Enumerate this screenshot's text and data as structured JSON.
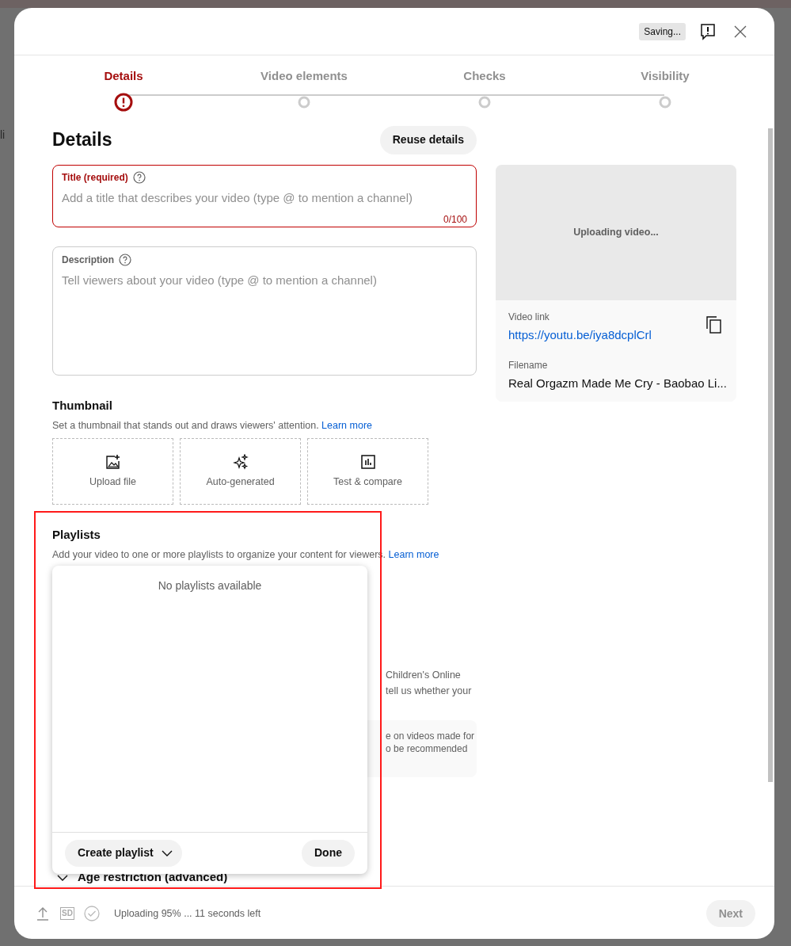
{
  "backdrop_text": "li",
  "header": {
    "status_badge": "Saving..."
  },
  "steps": [
    {
      "label": "Details",
      "selected": true,
      "error": true
    },
    {
      "label": "Video elements",
      "selected": false,
      "error": false
    },
    {
      "label": "Checks",
      "selected": false,
      "error": false
    },
    {
      "label": "Visibility",
      "selected": false,
      "error": false
    }
  ],
  "heading": "Details",
  "reuse_button": "Reuse details",
  "title_field": {
    "label": "Title (required)",
    "placeholder": "Add a title that describes your video (type @ to mention a channel)",
    "counter": "0/100",
    "error": true
  },
  "description_field": {
    "label": "Description",
    "placeholder": "Tell viewers about your video (type @ to mention a channel)"
  },
  "thumbnail": {
    "heading": "Thumbnail",
    "description": "Set a thumbnail that stands out and draws viewers' attention.",
    "link": "Learn more",
    "options": [
      {
        "kind": "upload",
        "label": "Upload file"
      },
      {
        "kind": "auto",
        "label": "Auto-generated"
      },
      {
        "kind": "test",
        "label": "Test & compare"
      }
    ]
  },
  "playlists": {
    "heading": "Playlists",
    "description": "Add your video to one or more playlists to organize your content for viewers.",
    "link": "Learn more",
    "popup": {
      "empty_text": "No playlists available",
      "create_button": "Create playlist",
      "done_button": "Done"
    }
  },
  "audience_fragments": [
    "Children's Online",
    "tell us whether your"
  ],
  "audience_note_fragments": [
    "e on videos made for",
    "o be recommended"
  ],
  "age_restriction": {
    "label": "Age restriction (advanced)",
    "expanded": false
  },
  "preview": {
    "status": "Uploading video...",
    "link_label": "Video link",
    "link": "https://youtu.be/iya8dcplCrl",
    "filename_label": "Filename",
    "filename": "Real Orgazm Made Me Cry - Baobao Li..."
  },
  "footer": {
    "status": "Uploading 95% ... 11 seconds left",
    "sd_label": "SD",
    "next_button": {
      "label": "Next",
      "disabled": true
    }
  }
}
